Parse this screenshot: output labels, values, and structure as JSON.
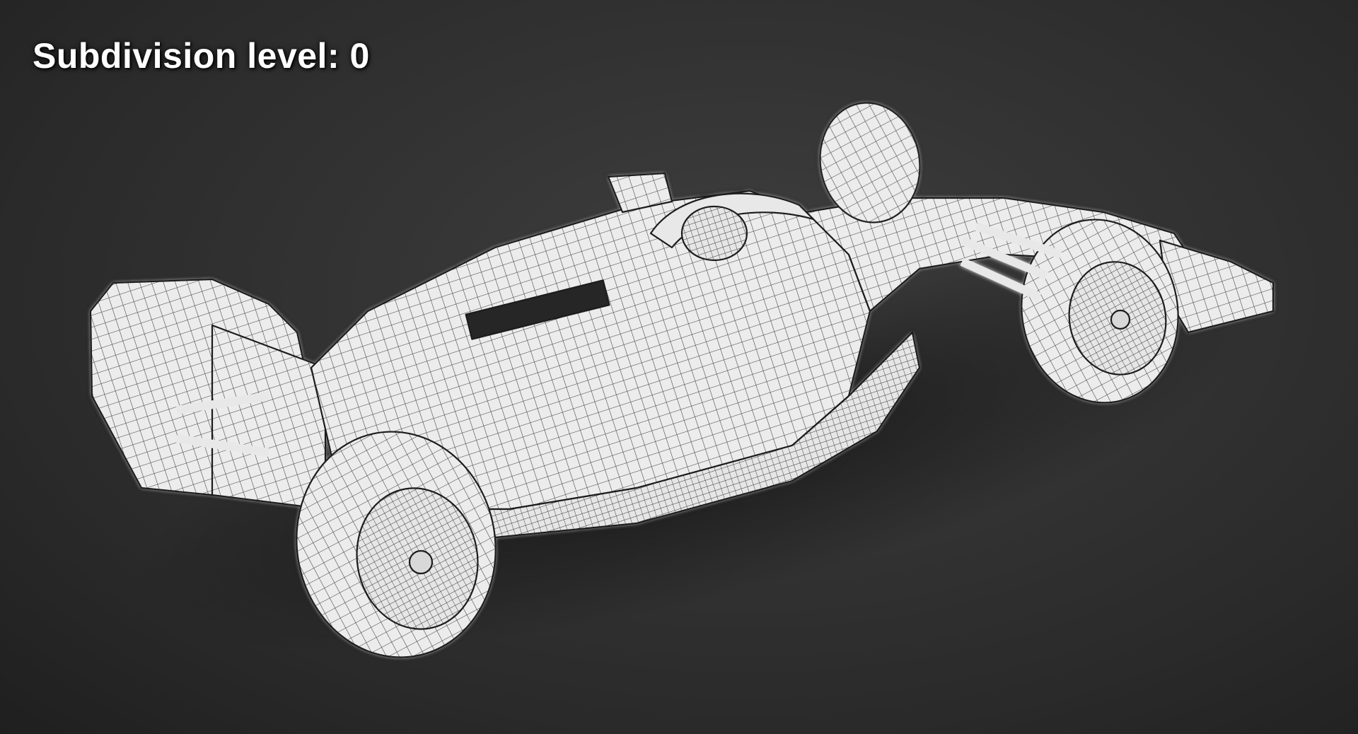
{
  "overlay": {
    "label": "Subdivision level: 0"
  },
  "viewport": {
    "background_color": "#2e2e2e",
    "model_color": "#eeeeee",
    "wire_color": "#2a2a2a",
    "subject": "formula-race-car-wireframe"
  }
}
